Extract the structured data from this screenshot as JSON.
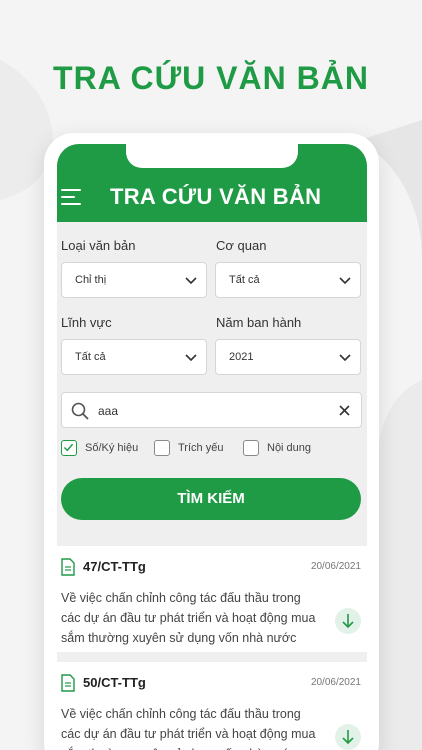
{
  "promo": {
    "title": "TRA CỨU VĂN BẢN"
  },
  "appbar": {
    "title": "TRA CỨU VĂN BẢN",
    "menu_icon": "hamburger-menu-icon"
  },
  "form": {
    "doc_type": {
      "label": "Loại văn bản",
      "value": "Chỉ thị"
    },
    "agency": {
      "label": "Cơ quan",
      "value": "Tất cả"
    },
    "field": {
      "label": "Lĩnh vực",
      "value": "Tất cả"
    },
    "year": {
      "label": "Năm ban hành",
      "value": "2021"
    },
    "search": {
      "value": "aaa"
    },
    "checkboxes": [
      {
        "label": "Số/Ký hiệu",
        "checked": true
      },
      {
        "label": "Trích yếu",
        "checked": false
      },
      {
        "label": "Nội dung",
        "checked": false
      }
    ],
    "submit_label": "TÌM KIẾM"
  },
  "results": [
    {
      "code": "47/CT-TTg",
      "date": "20/06/2021",
      "description": "Về việc chấn chỉnh công tác đấu thầu trong các dự án đầu tư phát triển và hoạt động mua sắm thường xuyên sử dụng vốn nhà nước"
    },
    {
      "code": "50/CT-TTg",
      "date": "20/06/2021",
      "description": "Về việc chấn chỉnh công tác đấu thầu trong các dự án đầu tư phát triển và hoạt động mua sắm thường xuyên sử dụng vốn nhà nước"
    }
  ],
  "colors": {
    "brand_green": "#1f9a45",
    "background": "#f4f4f4"
  }
}
